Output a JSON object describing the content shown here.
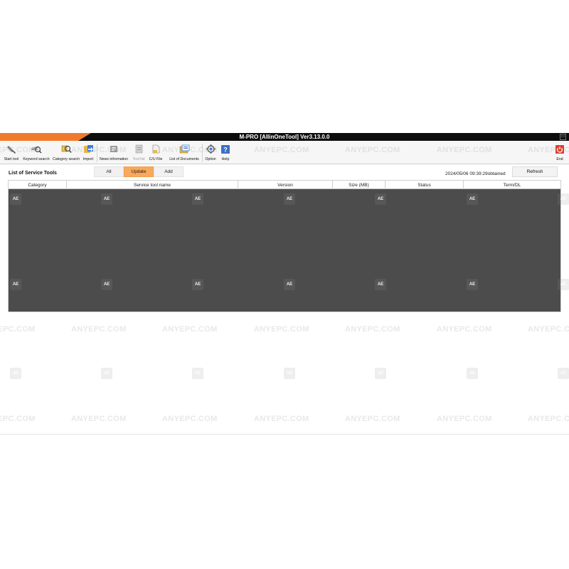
{
  "window": {
    "title": "M-PRO [AllinOneTool] Ver3.13.0.0"
  },
  "toolbar": {
    "items": [
      {
        "label": "Start tool",
        "icon": "start-tool-icon"
      },
      {
        "label": "Keyword search",
        "icon": "keyword-search-icon"
      },
      {
        "label": "Category search",
        "icon": "category-search-icon"
      },
      {
        "label": "Import",
        "icon": "import-icon"
      },
      {
        "label": "News information",
        "icon": "news-information-icon"
      },
      {
        "label": "Tool list",
        "icon": "tool-list-icon",
        "disabled": true
      },
      {
        "label": "C/U File",
        "icon": "cu-file-icon"
      },
      {
        "label": "List of Documents",
        "icon": "documents-icon"
      },
      {
        "label": "Option",
        "icon": "option-icon"
      },
      {
        "label": "Help",
        "icon": "help-icon"
      },
      {
        "label": "End",
        "icon": "power-icon"
      }
    ]
  },
  "main": {
    "section_title": "List of Service Tools",
    "filters": [
      {
        "label": "All",
        "active": false
      },
      {
        "label": "Update",
        "active": true
      },
      {
        "label": "Add",
        "active": false
      }
    ],
    "timestamp": "2024/05/06 09:39:29obtained",
    "refresh_label": "Refresh",
    "table": {
      "columns": [
        "Category",
        "Service tool name",
        "Version",
        "Size (MB)",
        "Status",
        "Term/DL"
      ],
      "rows": []
    }
  },
  "watermark": {
    "text": "ANYEPC.COM",
    "logo_text": "AE"
  },
  "colors": {
    "accent": "#f07a2a",
    "active_filter": "#f7a95e",
    "table_body": "#4c4c4c"
  }
}
